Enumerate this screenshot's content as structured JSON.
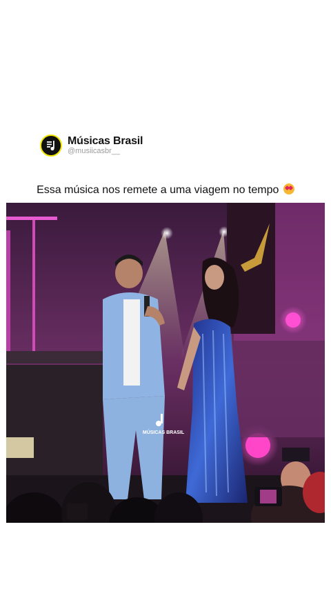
{
  "account": {
    "name": "Músicas Brasil",
    "handle": "@musiicasbr__",
    "avatar_icon": "music-note-icon",
    "avatar_ring_color": "#f2e600"
  },
  "caption": {
    "text": "Essa música nos remete a uma viagem no tempo",
    "emoji": "heart-eyes-emoji"
  },
  "video": {
    "watermark": "MÚSICAS BRASIL"
  },
  "colors": {
    "stage_pink": "#e63fd0",
    "suit_blue": "#8fb4e3",
    "dress_blue": "#2b49b8"
  }
}
